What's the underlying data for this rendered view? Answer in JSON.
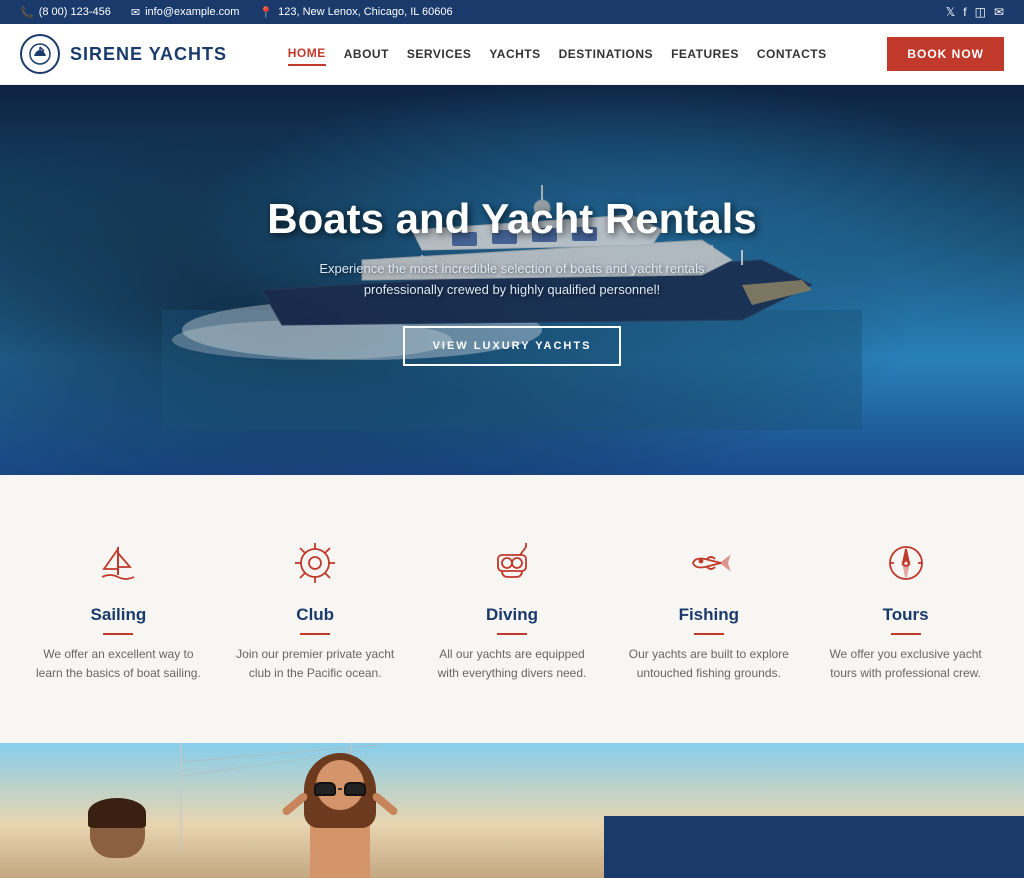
{
  "topbar": {
    "phone": "(8 00) 123-456",
    "email": "info@example.com",
    "address": "123, New Lenox, Chicago, IL 60606",
    "social": [
      "twitter",
      "facebook",
      "instagram",
      "email"
    ]
  },
  "header": {
    "logo_text": "SIRENE YACHTS",
    "nav": [
      {
        "label": "HOME",
        "active": true
      },
      {
        "label": "ABOUT",
        "active": false
      },
      {
        "label": "SERVICES",
        "active": false
      },
      {
        "label": "YACHTS",
        "active": false
      },
      {
        "label": "DESTINATIONS",
        "active": false
      },
      {
        "label": "FEATURES",
        "active": false
      },
      {
        "label": "CONTACTS",
        "active": false
      }
    ],
    "book_btn": "BOOK NOW"
  },
  "hero": {
    "title": "Boats and Yacht Rentals",
    "subtitle": "Experience the most incredible selection of boats and yacht rentals professionally crewed by highly qualified personnel!",
    "cta": "VIEW LUXURY YACHTS"
  },
  "features": [
    {
      "id": "sailing",
      "title": "Sailing",
      "desc": "We offer an excellent way to learn the basics of boat sailing."
    },
    {
      "id": "club",
      "title": "Club",
      "desc": "Join our premier private yacht club in the Pacific ocean."
    },
    {
      "id": "diving",
      "title": "Diving",
      "desc": "All our yachts are equipped with everything divers need."
    },
    {
      "id": "fishing",
      "title": "Fishing",
      "desc": "Our yachts are built to explore untouched fishing grounds."
    },
    {
      "id": "tours",
      "title": "Tours",
      "desc": "We offer you exclusive yacht tours with professional crew."
    }
  ]
}
